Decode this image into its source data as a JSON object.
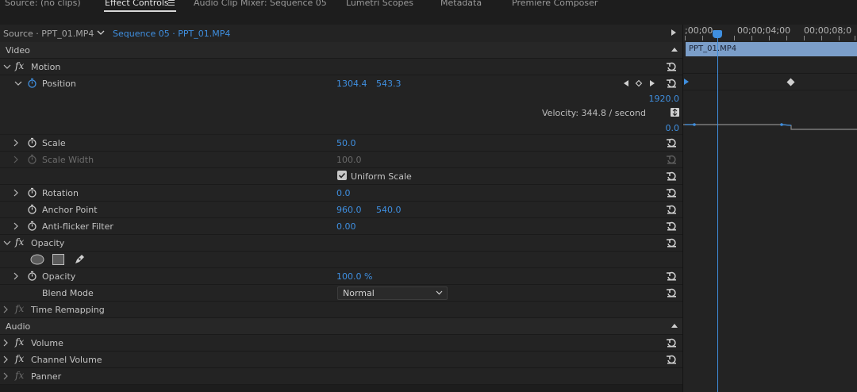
{
  "tabs": [
    {
      "label": "Source: (no clips)",
      "active": false
    },
    {
      "label": "Effect Controls",
      "active": true
    },
    {
      "label": "Audio Clip Mixer: Sequence 05",
      "active": false
    },
    {
      "label": "Lumetri Scopes",
      "active": false
    },
    {
      "label": "Metadata",
      "active": false
    },
    {
      "label": "Premiere Composer",
      "active": false
    }
  ],
  "source_bar": {
    "source": "Source · PPT_01.MP4",
    "sequence": "Sequence 05 · PPT_01.MP4"
  },
  "timeline": {
    "timecodes": [
      ";00;00",
      "00;00;04;00",
      "00;00;08;0"
    ],
    "clip_label": "PPT_01.MP4"
  },
  "video_section": {
    "label": "Video"
  },
  "motion": {
    "label": "Motion"
  },
  "position": {
    "label": "Position",
    "x": "1304.4",
    "y": "543.3"
  },
  "graph": {
    "max": "1920.0",
    "min": "0.0",
    "velocity": "Velocity: 344.8 / second"
  },
  "scale": {
    "label": "Scale",
    "value": "50.0"
  },
  "scale_width": {
    "label": "Scale Width",
    "value": "100.0"
  },
  "uniform_scale": {
    "label": "Uniform Scale",
    "checked": true
  },
  "rotation": {
    "label": "Rotation",
    "value": "0.0"
  },
  "anchor_point": {
    "label": "Anchor Point",
    "x": "960.0",
    "y": "540.0"
  },
  "anti_flicker": {
    "label": "Anti-flicker Filter",
    "value": "0.00"
  },
  "opacity_effect": {
    "label": "Opacity"
  },
  "opacity": {
    "label": "Opacity",
    "value": "100.0 %"
  },
  "blend_mode": {
    "label": "Blend Mode",
    "value": "Normal"
  },
  "time_remapping": {
    "label": "Time Remapping"
  },
  "audio_section": {
    "label": "Audio"
  },
  "volume": {
    "label": "Volume"
  },
  "channel_volume": {
    "label": "Channel Volume"
  },
  "panner": {
    "label": "Panner"
  },
  "colors": {
    "accent": "#3f8fe0",
    "clip": "#7b9ec9",
    "panel": "#232323"
  }
}
